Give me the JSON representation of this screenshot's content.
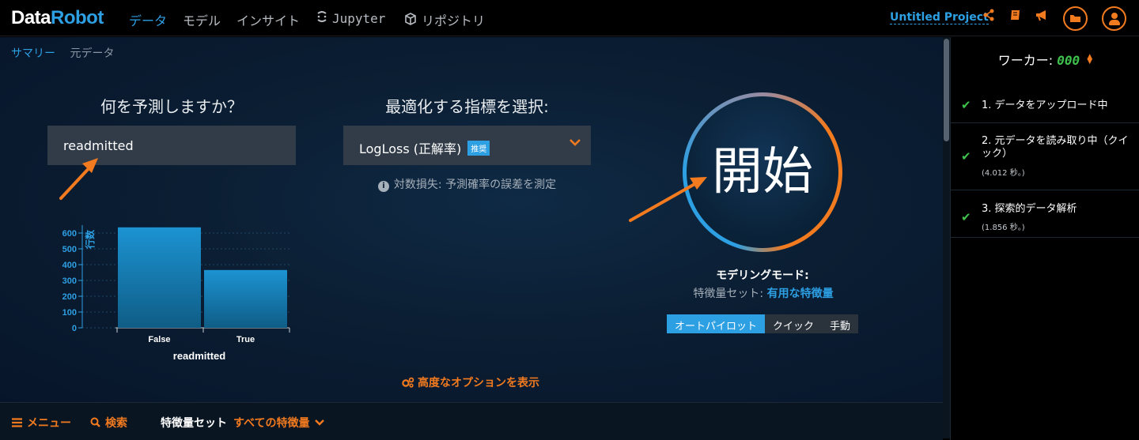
{
  "app": {
    "logo_part1": "Data",
    "logo_part2": "Robot",
    "project_name": "Untitled Project"
  },
  "nav": {
    "data": "データ",
    "model": "モデル",
    "insight": "インサイト",
    "jupyter": "Jupyter",
    "repository": "リポジトリ"
  },
  "subnav": {
    "summary": "サマリー",
    "raw_data": "元データ"
  },
  "target": {
    "title": "何を予測しますか？",
    "value": "readmitted"
  },
  "metric": {
    "title": "最適化する指標を選択:",
    "value": "LogLoss (正解率)",
    "badge": "推奨",
    "description": "対数損失: 予測確率の誤差を測定"
  },
  "chart_data": {
    "type": "bar",
    "categories": [
      "False",
      "True"
    ],
    "values": [
      636,
      366
    ],
    "xlabel": "readmitted",
    "ylabel": "行数",
    "ylim": [
      0,
      650
    ],
    "yticks": [
      0,
      100,
      200,
      300,
      400,
      500,
      600
    ],
    "color": "#1c8ec9"
  },
  "start": {
    "label": "開始",
    "modeling_mode_label": "モデリングモード:",
    "feature_set_label": "特徴量セット:",
    "feature_set_value": "有用な特徴量",
    "modes": [
      "オートパイロット",
      "クイック",
      "手動"
    ],
    "selected_mode": "オートパイロット"
  },
  "advanced": {
    "label": "高度なオプションを表示"
  },
  "bottombar": {
    "menu": "メニュー",
    "search": "検索",
    "feature_set_label": "特徴量セット",
    "feature_set_value": "すべての特徴量"
  },
  "workers": {
    "label": "ワーカー:",
    "count": "000"
  },
  "steps": [
    {
      "title": "1. データをアップロード中",
      "sub": ""
    },
    {
      "title": "2. 元データを読み取り中（クイック）",
      "sub": "(4.012 秒。)"
    },
    {
      "title": "3. 探索的データ解析",
      "sub": "(1.856 秒。)"
    }
  ],
  "colors": {
    "accent_blue": "#2d9fe3",
    "accent_orange": "#f27a1f",
    "success_green": "#3ec24d"
  }
}
